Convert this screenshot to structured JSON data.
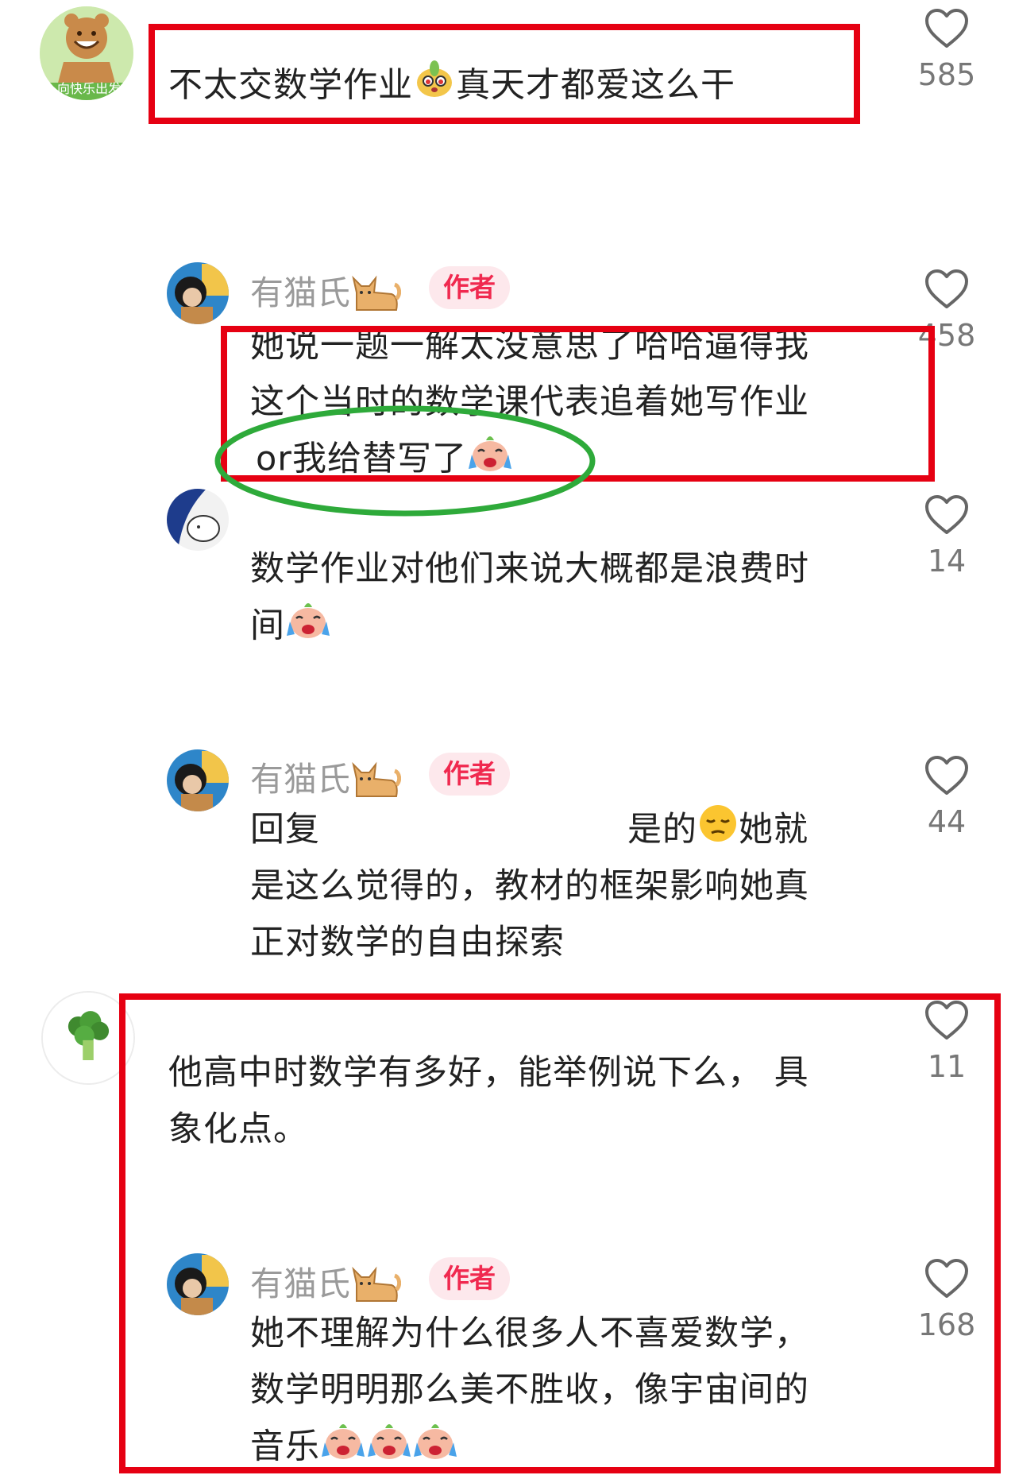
{
  "comments": [
    {
      "text": "不太交数学作业",
      "text_after_emoji": "真天才都爱这么干",
      "likes": "585",
      "avatar_icon": "cartoon-bear-icon",
      "avatar_caption": "向快乐出发"
    },
    {
      "username": "有猫氏",
      "badge": "作者",
      "line1": "她说一题一解太没意思了哈哈逼得我",
      "line2": "这个当时的数学课代表追着她写作业",
      "line3": "or我给替写了",
      "likes": "458"
    },
    {
      "line1": "数学作业对他们来说大概都是浪费时",
      "line2": "间",
      "likes": "14"
    },
    {
      "username": "有猫氏",
      "badge": "作者",
      "reply_prefix": "回复",
      "reply_mid": "是的",
      "reply_end": "她就",
      "line2": "是这么觉得的，教材的框架影响她真",
      "line3": "正对数学的自由探索",
      "likes": "44"
    },
    {
      "line1": "他高中时数学有多好，能举例说下么， 具",
      "line2": "象化点。",
      "likes": "11",
      "avatar_icon": "broccoli-icon"
    },
    {
      "username": "有猫氏",
      "badge": "作者",
      "line1": "她不理解为什么很多人不喜爱数学，",
      "line2": "数学明明那么美不胜收，像宇宙间的",
      "line3": "音乐",
      "likes": "168"
    }
  ],
  "colors": {
    "annotation_red": "#e60012",
    "annotation_green": "#2eaa3a",
    "badge_bg": "#fde8ec",
    "badge_text": "#f0294f"
  }
}
